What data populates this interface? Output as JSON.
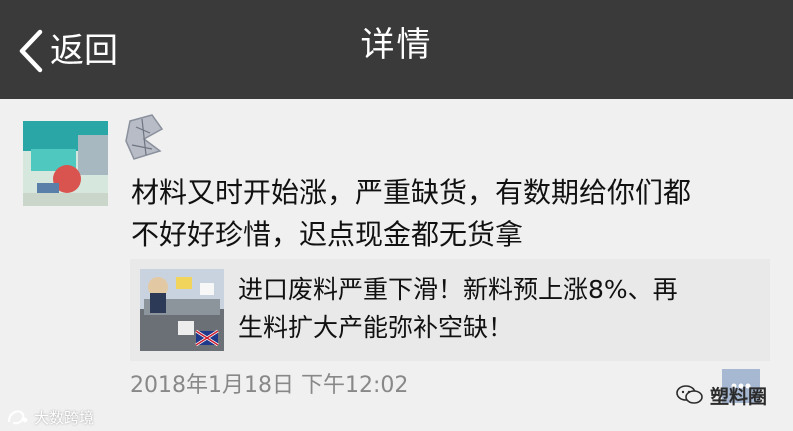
{
  "navbar": {
    "back_label": "返回",
    "title": "详情",
    "background": "#3a3a3a"
  },
  "post": {
    "text_line1": "材料又时开始涨，严重缺货，有数期给你们都",
    "text_line2": "不好好珍惜，迟点现金都无货拿",
    "link_card": {
      "title_line1": "进口废料严重下滑！新料预上涨8%、再",
      "title_line2": "生料扩大产能弥补空缺！"
    },
    "timestamp": "2018年1月18日 下午12:02"
  },
  "watermarks": {
    "right": "塑料圈",
    "left": "大数跨境"
  },
  "icons": {
    "back": "chevron-left-icon",
    "comment": "comment-icon",
    "watermark_right": "wechat-logo-icon",
    "watermark_left": "brand-logo-icon"
  }
}
